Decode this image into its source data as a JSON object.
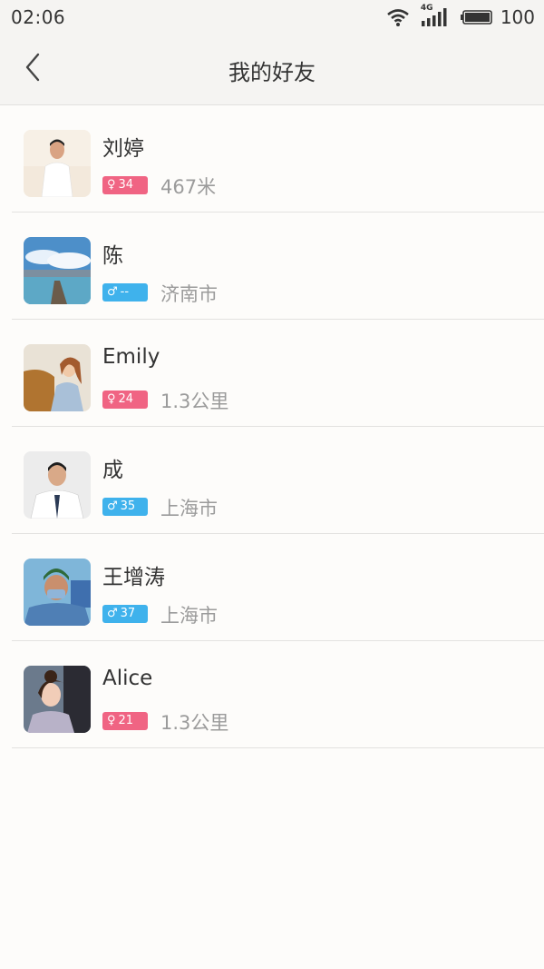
{
  "status_bar": {
    "time": "02:06",
    "network_label": "4G",
    "battery_level": "100",
    "icons": [
      "wifi-icon",
      "signal-icon",
      "battery-icon"
    ]
  },
  "header": {
    "title": "我的好友",
    "back_icon": "chevron-left-icon"
  },
  "colors": {
    "female_badge": "#f06483",
    "male_badge": "#3fb2ec",
    "background": "#fdfcfa"
  },
  "friends": [
    {
      "name": "刘婷",
      "gender": "female",
      "gender_symbol": "♀",
      "age": "34",
      "location": "467米"
    },
    {
      "name": "陈",
      "gender": "male",
      "gender_symbol": "♂",
      "age": "--",
      "location": "济南市"
    },
    {
      "name": "Emily",
      "gender": "female",
      "gender_symbol": "♀",
      "age": "24",
      "location": "1.3公里"
    },
    {
      "name": "成",
      "gender": "male",
      "gender_symbol": "♂",
      "age": "35",
      "location": "上海市"
    },
    {
      "name": "王增涛",
      "gender": "male",
      "gender_symbol": "♂",
      "age": "37",
      "location": "上海市"
    },
    {
      "name": "Alice",
      "gender": "female",
      "gender_symbol": "♀",
      "age": "21",
      "location": "1.3公里"
    }
  ]
}
